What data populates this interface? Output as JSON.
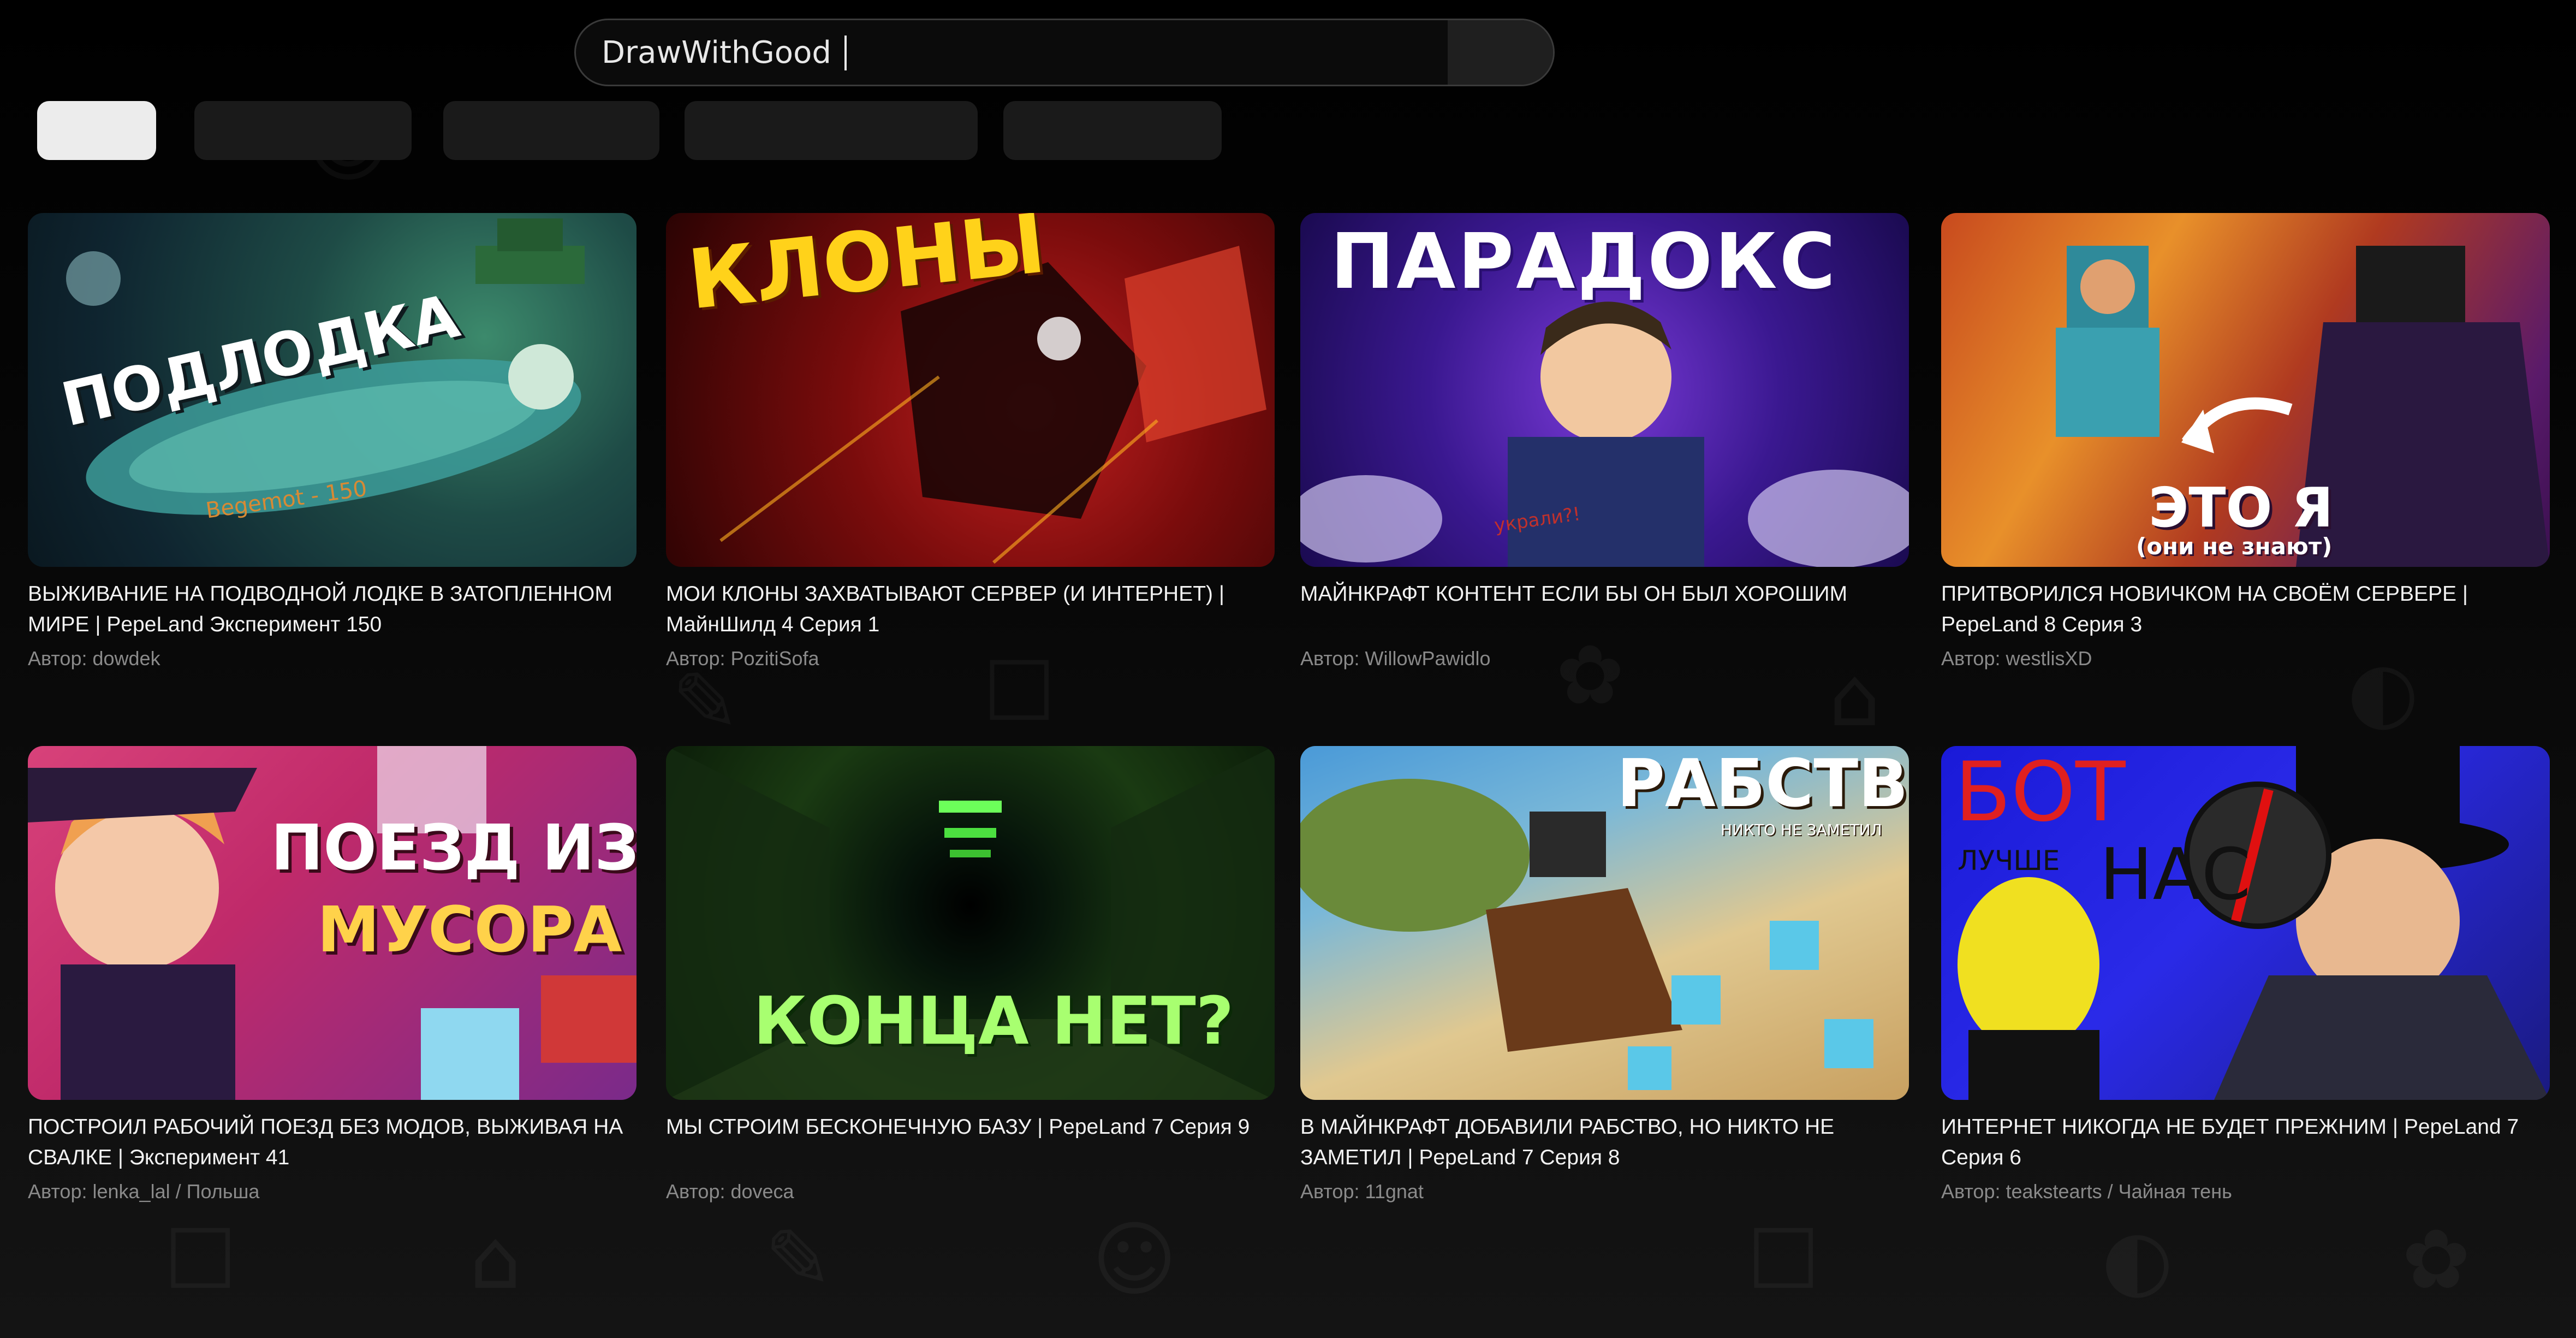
{
  "search": {
    "value": "DrawWithGood"
  },
  "chips": [
    {
      "label": ""
    },
    {
      "label": ""
    },
    {
      "label": ""
    },
    {
      "label": ""
    },
    {
      "label": ""
    }
  ],
  "author_prefix": "Автор:",
  "videos": [
    {
      "thumb_text": "ПОДЛОДКА",
      "thumb_sub": "Begemot - 150",
      "title": "ВЫЖИВАНИЕ НА ПОДВОДНОЙ ЛОДКЕ В ЗАТОПЛЕННОМ МИРЕ | PepeLand Эксперимент 150",
      "author": "dowdek"
    },
    {
      "thumb_text": "КЛОНЫ",
      "title": "МОИ КЛОНЫ ЗАХВАТЫВАЮТ СЕРВЕР (И ИНТЕРНЕТ) | МайнШилд 4 Серия 1",
      "author": "PozitiSofa"
    },
    {
      "thumb_text": "ПАРАДОКС",
      "thumb_sub": "украли?!",
      "title": "МАЙНКРАФТ КОНТЕНТ ЕСЛИ БЫ ОН БЫЛ ХОРОШИМ",
      "author": "WillowPawidlo"
    },
    {
      "thumb_text": "ЭТО Я",
      "thumb_sub": "(они не знают)",
      "title": "ПРИТВОРИЛСЯ НОВИЧКОМ НА СВОЁМ СЕРВЕРЕ | PepeLand 8 Серия 3",
      "author": "westlisXD"
    },
    {
      "thumb_text": "ПОЕЗД ИЗ",
      "thumb_text2": "МУСОРА",
      "title": "ПОСТРОИЛ РАБОЧИЙ ПОЕЗД БЕЗ МОДОВ, ВЫЖИВАЯ НА СВАЛКЕ | Эксперимент 41",
      "author": "lenka_lal / Польша"
    },
    {
      "thumb_text": "КОНЦА НЕТ?",
      "title": "МЫ СТРОИМ БЕСКОНЕЧНУЮ БАЗУ | PepeLand 7 Серия 9",
      "author": "doveca"
    },
    {
      "thumb_text": "РАБСТВО",
      "thumb_sub": "НИКТО НЕ ЗАМЕТИЛ",
      "title": "В МАЙНКРАФТ ДОБАВИЛИ РАБСТВО, НО НИКТО НЕ ЗАМЕТИЛ | PepeLand 7 Серия 8",
      "author": "11gnat"
    },
    {
      "thumb_text": "БОТ",
      "thumb_sub": "ЛУЧШЕ",
      "thumb_text2": "НАС",
      "title": "ИНТЕРНЕТ НИКОГДА НЕ БУДЕТ ПРЕЖНИМ | PepeLand 7 Серия 6",
      "author": "teakstearts / Чайная тень"
    }
  ]
}
